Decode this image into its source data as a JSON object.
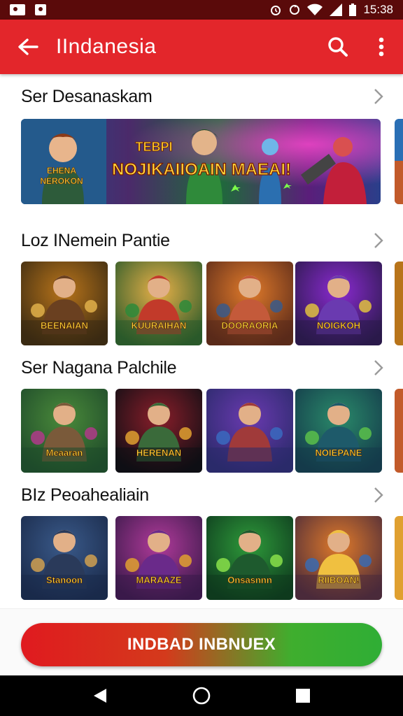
{
  "status_bar": {
    "time": "15:38"
  },
  "app_bar": {
    "title": "IIndanesia",
    "back_icon": "arrow-left-icon",
    "search_icon": "search-icon",
    "menu_icon": "more-vert-icon"
  },
  "sections": [
    {
      "title": "Ser Desanaskam",
      "banner": {
        "left_caption": "EHENA\nNEROKON",
        "headline_top": "TEBPI",
        "headline": "NOJIKAIIOAIN MAEAI!"
      }
    },
    {
      "title": "Loz INemein Pantie",
      "tiles": [
        {
          "caption": "BEENAIAN",
          "theme": "gold"
        },
        {
          "caption": "KUURAIHAN",
          "theme": "green"
        },
        {
          "caption": "DOORAORIA",
          "theme": "orange"
        },
        {
          "caption": "NOIGKOH",
          "theme": "purple"
        }
      ]
    },
    {
      "title": "Ser Nagana Palchile",
      "tiles": [
        {
          "caption": "Meaaran",
          "theme": "forest"
        },
        {
          "caption": "HERENAN",
          "theme": "dark"
        },
        {
          "caption": "",
          "theme": "violet"
        },
        {
          "caption": "NOIEPANE",
          "theme": "teal"
        }
      ]
    },
    {
      "title": "BIz Peoahealiain",
      "tiles": [
        {
          "caption": "Stanoon",
          "theme": "blue"
        },
        {
          "caption": "MARAAZE",
          "theme": "magenta"
        },
        {
          "caption": "Onsasnnn",
          "theme": "emerald"
        },
        {
          "caption": "RIIBOAN!",
          "theme": "sunset"
        }
      ]
    }
  ],
  "cta": {
    "label": "INDBAD INBNUEX"
  },
  "colors": {
    "accent": "#e3262b",
    "status_bar": "#5a0a0a",
    "cta_start": "#e01a1f",
    "cta_end": "#2fae35"
  },
  "nav": {
    "back_icon": "nav-back-icon",
    "home_icon": "nav-home-icon",
    "recents_icon": "nav-recents-icon"
  }
}
